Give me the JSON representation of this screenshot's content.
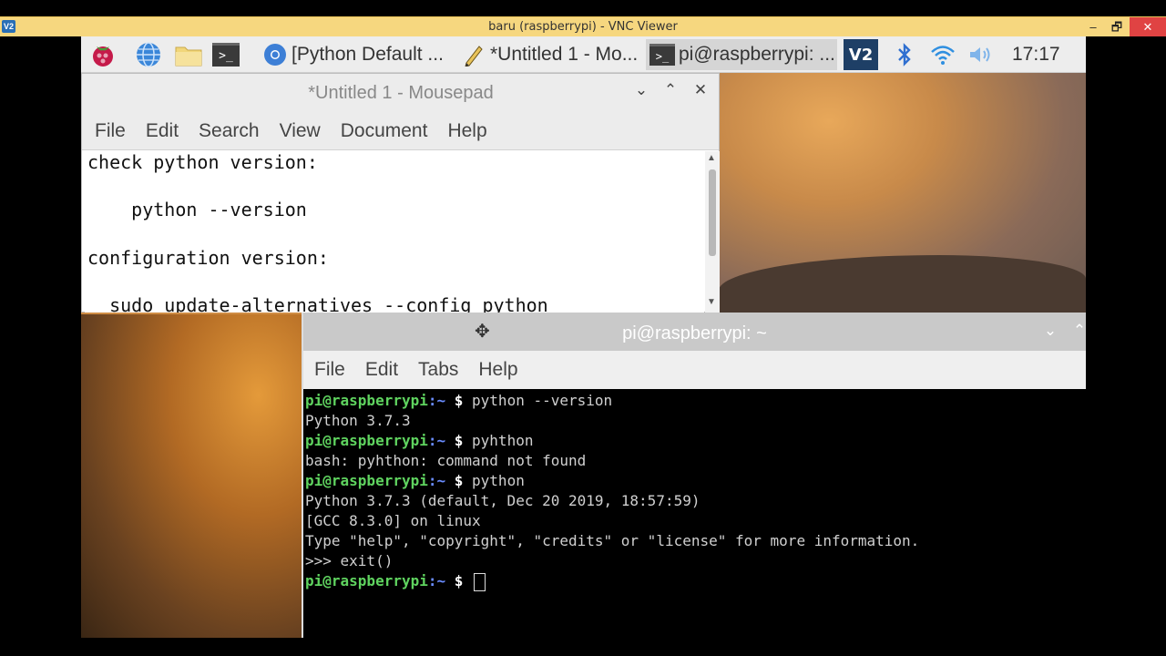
{
  "vnc": {
    "logo": "V2",
    "title": "baru (raspberrypi) - VNC Viewer",
    "minimize": "‒",
    "restore": "🗗",
    "close": "✕"
  },
  "taskbar": {
    "icons": [
      "raspberry-icon",
      "browser-globe-icon",
      "file-manager-icon",
      "terminal-icon"
    ],
    "tasks": [
      {
        "label": "[Python Default ...",
        "icon": "chromium-icon"
      },
      {
        "label": "*Untitled 1 - Mo...",
        "icon": "mousepad-icon"
      },
      {
        "label": "pi@raspberrypi: ...",
        "icon": "terminal-icon"
      }
    ],
    "tray": [
      "vnc-tray-icon",
      "bluetooth-icon",
      "wifi-icon",
      "volume-icon"
    ],
    "clock": "17:17"
  },
  "mousepad": {
    "title": "*Untitled 1 - Mousepad",
    "menu": [
      "File",
      "Edit",
      "Search",
      "View",
      "Document",
      "Help"
    ],
    "lines": [
      "check python version:",
      "",
      "    python --version",
      "",
      "configuration version:",
      "",
      "  sudo update-alternatives --config python"
    ]
  },
  "terminal": {
    "title": "pi@raspberrypi: ~",
    "menu": [
      "File",
      "Edit",
      "Tabs",
      "Help"
    ],
    "prompt_user": "pi@raspberrypi",
    "prompt_path": ":~",
    "prompt_dollar": " $ ",
    "lines": [
      {
        "type": "prompt",
        "cmd": "python --version"
      },
      {
        "type": "out",
        "text": "Python 3.7.3"
      },
      {
        "type": "prompt",
        "cmd": "pyhthon"
      },
      {
        "type": "out",
        "text": "bash: pyhthon: command not found"
      },
      {
        "type": "prompt",
        "cmd": "python"
      },
      {
        "type": "out",
        "text": "Python 3.7.3 (default, Dec 20 2019, 18:57:59)"
      },
      {
        "type": "out",
        "text": "[GCC 8.3.0] on linux"
      },
      {
        "type": "out",
        "text": "Type \"help\", \"copyright\", \"credits\" or \"license\" for more information."
      },
      {
        "type": "out",
        "text": ">>> exit()"
      },
      {
        "type": "prompt",
        "cmd": ""
      }
    ]
  }
}
